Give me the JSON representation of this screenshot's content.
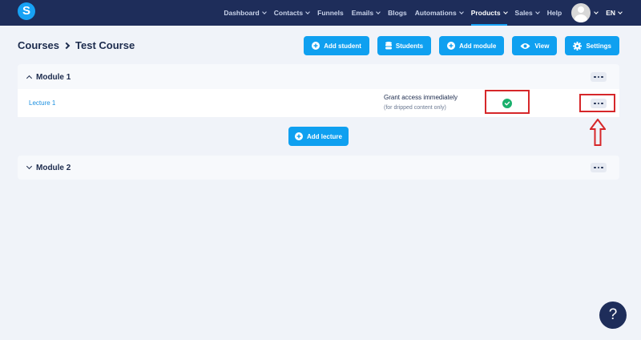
{
  "nav": {
    "logo_letter": "S",
    "items": [
      {
        "label": "Dashboard",
        "dropdown": true
      },
      {
        "label": "Contacts",
        "dropdown": true
      },
      {
        "label": "Funnels",
        "dropdown": false
      },
      {
        "label": "Emails",
        "dropdown": true
      },
      {
        "label": "Blogs",
        "dropdown": false
      },
      {
        "label": "Automations",
        "dropdown": true
      },
      {
        "label": "Products",
        "dropdown": true,
        "active": true
      },
      {
        "label": "Sales",
        "dropdown": true
      },
      {
        "label": "Help",
        "dropdown": false
      }
    ],
    "language": "EN"
  },
  "header": {
    "breadcrumb_root": "Courses",
    "breadcrumb_current": "Test Course",
    "buttons": {
      "add_student": "Add student",
      "students": "Students",
      "add_module": "Add module",
      "view": "View",
      "settings": "Settings"
    }
  },
  "modules": [
    {
      "title": "Module 1",
      "expanded": true,
      "lectures": [
        {
          "title": "Lecture 1",
          "access_label": "Grant access immediately",
          "access_sub": "(for dripped content only)",
          "access_enabled": true
        }
      ]
    },
    {
      "title": "Module 2",
      "expanded": false
    }
  ],
  "add_lecture_label": "Add lecture",
  "help_label": "?",
  "colors": {
    "nav_bg": "#1e2d5a",
    "accent": "#0fa0f0",
    "success": "#19b06c",
    "highlight_red": "#d6272a",
    "page_bg": "#f0f3f9"
  }
}
